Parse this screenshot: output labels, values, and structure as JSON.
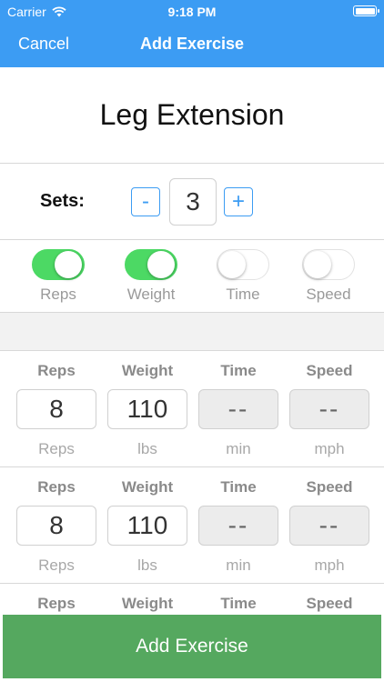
{
  "status_bar": {
    "carrier": "Carrier",
    "time": "9:18 PM"
  },
  "nav": {
    "cancel_label": "Cancel",
    "title": "Add Exercise"
  },
  "exercise_name": "Leg Extension",
  "sets": {
    "label": "Sets:",
    "minus": "-",
    "value": "3",
    "plus": "+"
  },
  "toggles": [
    {
      "label": "Reps",
      "on": true
    },
    {
      "label": "Weight",
      "on": true
    },
    {
      "label": "Time",
      "on": false
    },
    {
      "label": "Speed",
      "on": false
    }
  ],
  "set_rows": [
    {
      "fields": [
        {
          "header": "Reps",
          "value": "8",
          "unit": "Reps",
          "enabled": true
        },
        {
          "header": "Weight",
          "value": "110",
          "unit": "lbs",
          "enabled": true
        },
        {
          "header": "Time",
          "value": "--",
          "unit": "min",
          "enabled": false
        },
        {
          "header": "Speed",
          "value": "--",
          "unit": "mph",
          "enabled": false
        }
      ]
    },
    {
      "fields": [
        {
          "header": "Reps",
          "value": "8",
          "unit": "Reps",
          "enabled": true
        },
        {
          "header": "Weight",
          "value": "110",
          "unit": "lbs",
          "enabled": true
        },
        {
          "header": "Time",
          "value": "--",
          "unit": "min",
          "enabled": false
        },
        {
          "header": "Speed",
          "value": "--",
          "unit": "mph",
          "enabled": false
        }
      ]
    },
    {
      "fields": [
        {
          "header": "Reps"
        },
        {
          "header": "Weight"
        },
        {
          "header": "Time"
        },
        {
          "header": "Speed"
        }
      ]
    }
  ],
  "add_button_label": "Add Exercise",
  "colors": {
    "accent": "#3c9cf3",
    "toggle_on": "#4cd964",
    "add_button": "#55a85f"
  }
}
